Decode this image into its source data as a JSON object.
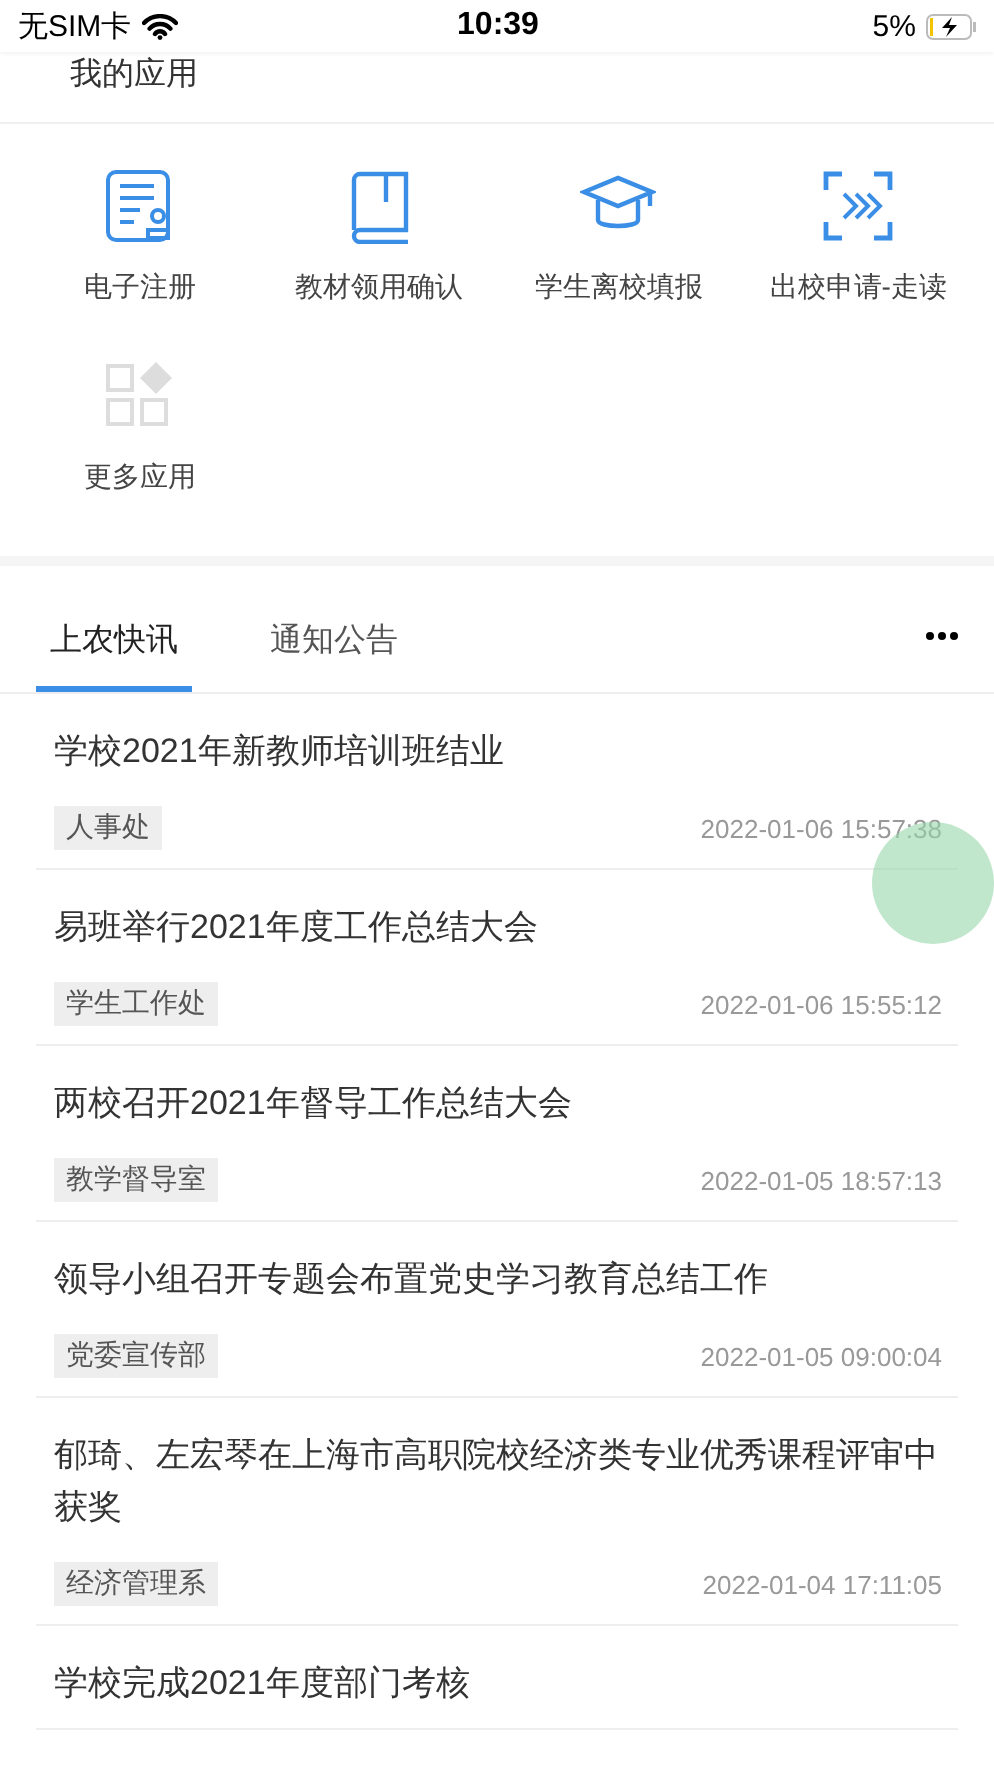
{
  "status_bar": {
    "carrier": "无SIM卡",
    "time": "10:39",
    "battery": "5%"
  },
  "header": {
    "title": "我的应用"
  },
  "apps": [
    {
      "label": "电子注册",
      "kind": "register"
    },
    {
      "label": "教材领用确认",
      "kind": "book"
    },
    {
      "label": "学生离校填报",
      "kind": "cap"
    },
    {
      "label": "出校申请-走读",
      "kind": "scan"
    },
    {
      "label": "更多应用",
      "kind": "more"
    }
  ],
  "tabs": [
    {
      "label": "上农快讯",
      "selected": true
    },
    {
      "label": "通知公告",
      "selected": false
    }
  ],
  "news": [
    {
      "title": "学校2021年新教师培训班结业",
      "tag": "人事处",
      "time": "2022-01-06 15:57:38"
    },
    {
      "title": "易班举行2021年度工作总结大会",
      "tag": "学生工作处",
      "time": "2022-01-06 15:55:12"
    },
    {
      "title": "两校召开2021年督导工作总结大会",
      "tag": "教学督导室",
      "time": "2022-01-05 18:57:13"
    },
    {
      "title": "领导小组召开专题会布置党史学习教育总结工作",
      "tag": "党委宣传部",
      "time": "2022-01-05 09:00:04"
    },
    {
      "title": "郁琦、左宏琴在上海市高职院校经济类专业优秀课程评审中获奖",
      "tag": "经济管理系",
      "time": "2022-01-04 17:11:05"
    },
    {
      "title": "学校完成2021年度部门考核"
    }
  ]
}
